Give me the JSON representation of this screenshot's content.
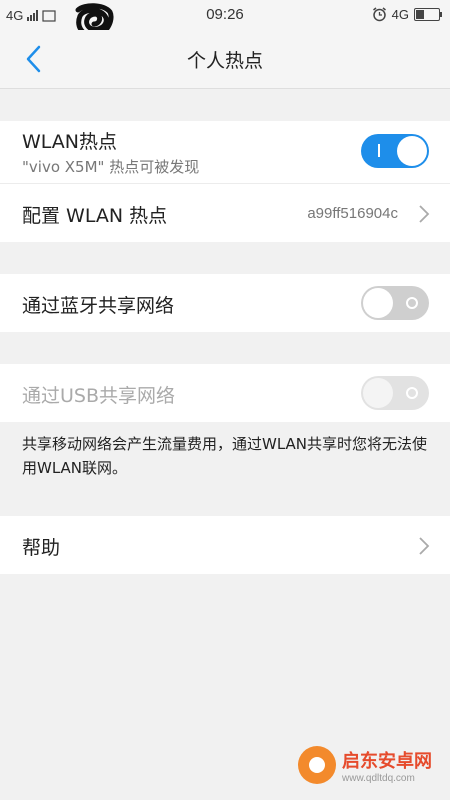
{
  "status_bar": {
    "network_left": "4G",
    "time": "09:26",
    "network_right": "4G"
  },
  "header": {
    "title": "个人热点"
  },
  "wlan_section": {
    "hotspot_title": "WLAN热点",
    "hotspot_subtitle": "\"vivo X5M\" 热点可被发现",
    "hotspot_on": true,
    "configure_label": "配置 WLAN 热点",
    "configure_value": "a99ff516904c"
  },
  "bluetooth_section": {
    "label": "通过蓝牙共享网络",
    "on": false
  },
  "usb_section": {
    "label": "通过USB共享网络",
    "on": false,
    "enabled": false
  },
  "note": "共享移动网络会产生流量费用，通过WLAN共享时您将无法使用WLAN联网。",
  "help_section": {
    "label": "帮助"
  },
  "watermark": {
    "name": "启东安卓网",
    "url": "www.qdltdq.com"
  },
  "colors": {
    "accent": "#1e8eea",
    "toggle_off": "#cfcfcf",
    "background": "#f1f1f1"
  }
}
